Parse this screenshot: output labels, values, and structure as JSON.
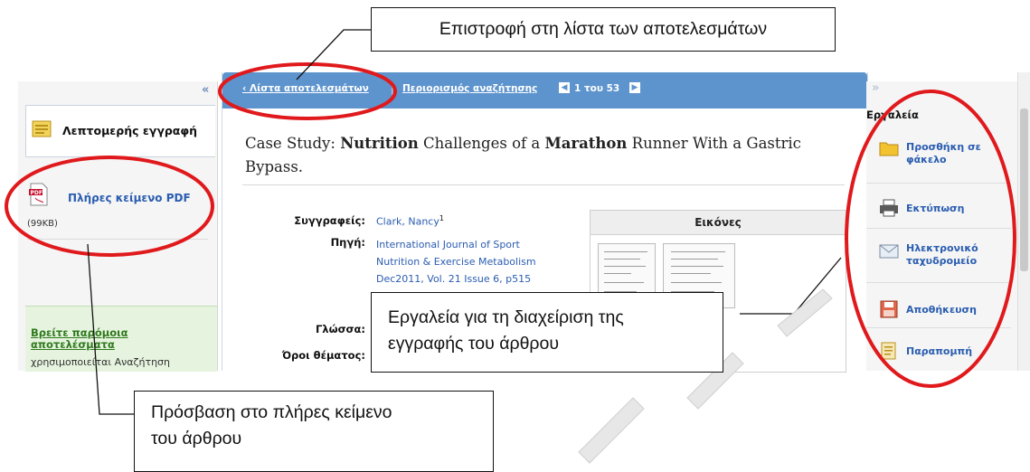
{
  "callouts": {
    "top": "Επιστροφή στη λίστα των αποτελεσμάτων",
    "tools_line1": "Εργαλεία για τη διαχείριση της",
    "tools_line2": "εγγραφής του άρθρου",
    "fulltext_line1": "Πρόσβαση στο πλήρες κείμενο",
    "fulltext_line2": "του άρθρου"
  },
  "left_panel": {
    "collapse": "«",
    "detail_label": "Λεπτομερής εγγραφή",
    "pdf_label": "Πλήρες κείμενο PDF",
    "pdf_size": "(99KB)",
    "similar_link": "Βρείτε παρόμοια αποτελέσματα",
    "similar_text": "χρησιμοποιείται Αναζήτηση"
  },
  "header": {
    "back_label": "‹ Λίστα αποτελεσμάτων",
    "separator": "|",
    "refine_label": "Περιορισμός αναζήτησης",
    "page_count": "1 του 53"
  },
  "article": {
    "title_part1": "Case Study: ",
    "title_bold1": "Nutrition",
    "title_part2": " Challenges of a ",
    "title_bold2": "Marathon",
    "title_part3": " Runner With a Gastric Bypass.",
    "authors_label": "Συγγραφείς:",
    "authors_value": "Clark, Nancy",
    "authors_sup": "1",
    "source_label": "Πηγή:",
    "source_value": "International Journal of Sport Nutrition & Exercise Metabolism Dec2011, Vol. 21 Issue 6, p515",
    "language_label": "Γλώσσα:",
    "subject_label": "Όροι θέματος:",
    "images_title": "Εικόνες"
  },
  "tools": {
    "collapse": "»",
    "title": "Εργαλεία",
    "add_folder": "Προσθήκη σε φάκελο",
    "print": "Εκτύπωση",
    "email": "Ηλεκτρονικό ταχυδρομείο",
    "save": "Αποθήκευση",
    "cite": "Παραπομπή"
  },
  "colors": {
    "header_blue": "#5e94cd",
    "link_blue": "#2a5db0",
    "annotation_red": "#e0191c"
  }
}
